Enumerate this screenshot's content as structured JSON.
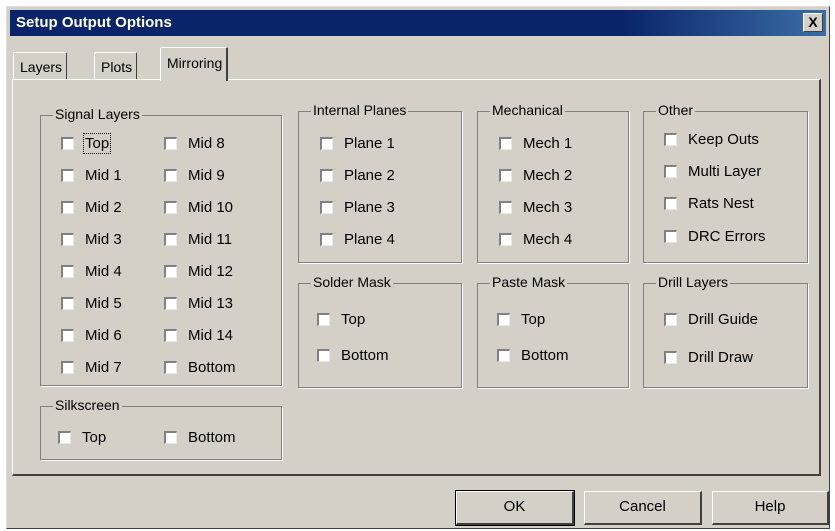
{
  "window": {
    "title": "Setup Output Options",
    "close_label": "X"
  },
  "tabs": [
    {
      "label": "Layers"
    },
    {
      "label": "Plots"
    },
    {
      "label": "Mirroring",
      "active": true
    }
  ],
  "groups": {
    "signal_layers": {
      "label": "Signal Layers",
      "left": [
        "Top",
        "Mid 1",
        "Mid 2",
        "Mid 3",
        "Mid 4",
        "Mid 5",
        "Mid 6",
        "Mid 7"
      ],
      "right": [
        "Mid 8",
        "Mid 9",
        "Mid 10",
        "Mid 11",
        "Mid 12",
        "Mid 13",
        "Mid 14",
        "Bottom"
      ]
    },
    "silkscreen": {
      "label": "Silkscreen",
      "items": [
        "Top",
        "Bottom"
      ]
    },
    "internal_planes": {
      "label": "Internal Planes",
      "items": [
        "Plane 1",
        "Plane 2",
        "Plane 3",
        "Plane 4"
      ]
    },
    "mechanical": {
      "label": "Mechanical",
      "items": [
        "Mech 1",
        "Mech 2",
        "Mech 3",
        "Mech 4"
      ]
    },
    "other": {
      "label": "Other",
      "items": [
        "Keep Outs",
        "Multi Layer",
        "Rats Nest",
        "DRC Errors"
      ]
    },
    "solder_mask": {
      "label": "Solder Mask",
      "items": [
        "Top",
        "Bottom"
      ]
    },
    "paste_mask": {
      "label": "Paste Mask",
      "items": [
        "Top",
        "Bottom"
      ]
    },
    "drill_layers": {
      "label": "Drill Layers",
      "items": [
        "Drill Guide",
        "Drill Draw"
      ]
    }
  },
  "buttons": {
    "ok": "OK",
    "cancel": "Cancel",
    "help": "Help"
  },
  "colors": {
    "face": "#d4d0c8",
    "title_bar": "#0a246a",
    "shadow": "#808080"
  }
}
